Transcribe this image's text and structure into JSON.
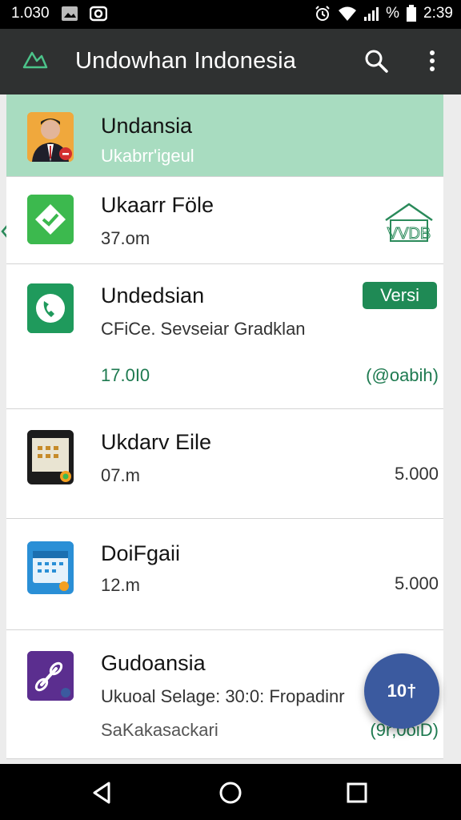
{
  "status_bar": {
    "time_left": "1.030",
    "time_right": "2:39",
    "battery_text": "%"
  },
  "app_bar": {
    "title": "Undowhan Indonesia",
    "logo_icon": "triangle-logo-icon",
    "search_icon": "search-icon",
    "menu_icon": "more-vert-icon"
  },
  "items": [
    {
      "title": "Undansia",
      "subtitle": "Ukabrr'igeul",
      "icon": "person-avatar-icon",
      "selected": true
    },
    {
      "title": "Ukaarr Föle",
      "subtitle": "37.om",
      "right": "VVDB",
      "icon": "green-check-icon"
    },
    {
      "title": "Undedsian",
      "subtitle": "CFiCe. Sevseiar Gradklan",
      "meta": "17.0I0",
      "badge": "Versi",
      "right": "(@oabih)",
      "icon": "phone-icon"
    },
    {
      "title": "Ukdarv Eile",
      "subtitle": "07.m",
      "right": "5.000",
      "icon": "tablet-icon"
    },
    {
      "title": "DoiFgaii",
      "subtitle": "12.m",
      "right": "5.000",
      "icon": "calendar-icon"
    },
    {
      "title": "Gudoansia",
      "subtitle": "Ukuoal Selage: 30:0: Fropadinr",
      "meta": "SaKakasackari",
      "right": "(9r;0oiD)",
      "icon": "link-icon"
    }
  ],
  "fab": {
    "label": "10†"
  },
  "colors": {
    "app_bar": "#2f3131",
    "selected": "#a8dcc0",
    "accent": "#1f8a55",
    "fab": "#3b5a9f"
  }
}
